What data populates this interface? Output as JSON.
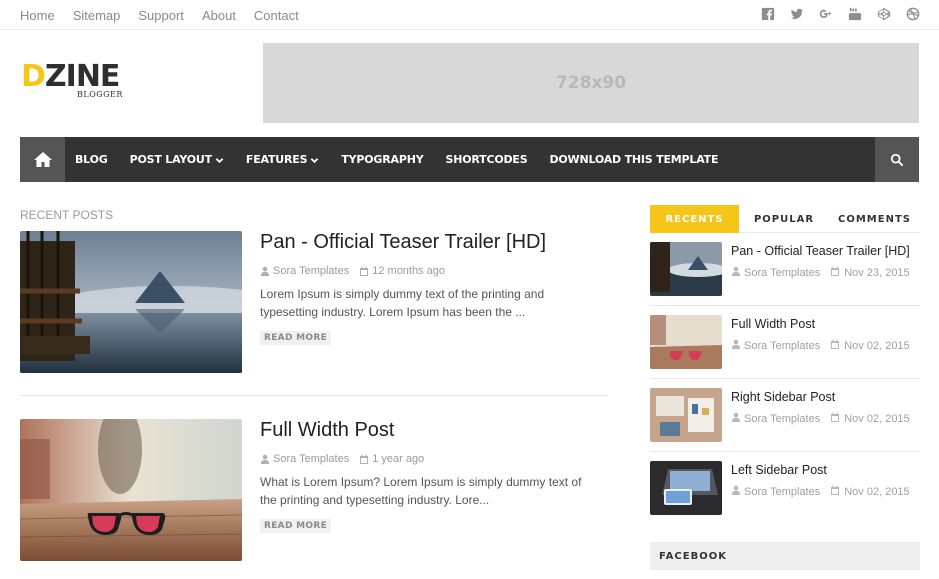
{
  "topbar": {
    "links": [
      "Home",
      "Sitemap",
      "Support",
      "About",
      "Contact"
    ],
    "social": [
      "facebook-icon",
      "twitter-icon",
      "google-plus-icon",
      "youtube-icon",
      "codepen-icon",
      "dribbble-icon"
    ]
  },
  "header": {
    "logo_main_first": "D",
    "logo_main_rest": "ZINE",
    "logo_sub": "BLOGGER",
    "ad_label": "728x90"
  },
  "nav": {
    "items": [
      {
        "label": "BLOG"
      },
      {
        "label": "POST LAYOUT"
      },
      {
        "label": "FEATURES"
      },
      {
        "label": "TYPOGRAPHY"
      },
      {
        "label": "SHORTCODES"
      },
      {
        "label": "DOWNLOAD THIS TEMPLATE"
      }
    ]
  },
  "main": {
    "section_title": "RECENT POSTS",
    "posts": [
      {
        "title": "Pan - Official Teaser Trailer [HD]",
        "author": "Sora Templates",
        "date": "12 months ago",
        "excerpt": "Lorem Ipsum is simply dummy text of the printing and typesetting industry. Lorem Ipsum has been the ...",
        "read_more": "READ MORE"
      },
      {
        "title": "Full Width Post",
        "author": "Sora Templates",
        "date": "1 year ago",
        "excerpt": "What is Lorem Ipsum? Lorem Ipsum is simply dummy text of the printing and typesetting industry. Lore...",
        "read_more": "READ MORE"
      }
    ]
  },
  "sidebar": {
    "tabs": [
      "RECENTS",
      "POPULAR",
      "COMMENTS"
    ],
    "items": [
      {
        "title": "Pan - Official Teaser Trailer [HD]",
        "author": "Sora Templates",
        "date": "Nov 23, 2015"
      },
      {
        "title": "Full Width Post",
        "author": "Sora Templates",
        "date": "Nov 02, 2015"
      },
      {
        "title": "Right Sidebar Post",
        "author": "Sora Templates",
        "date": "Nov 02, 2015"
      },
      {
        "title": "Left Sidebar Post",
        "author": "Sora Templates",
        "date": "Nov 02, 2015"
      }
    ],
    "facebook_title": "FACEBOOK"
  },
  "colors": {
    "accent": "#f5c518",
    "nav_bg": "#333333",
    "nav_button_bg": "#555555"
  }
}
